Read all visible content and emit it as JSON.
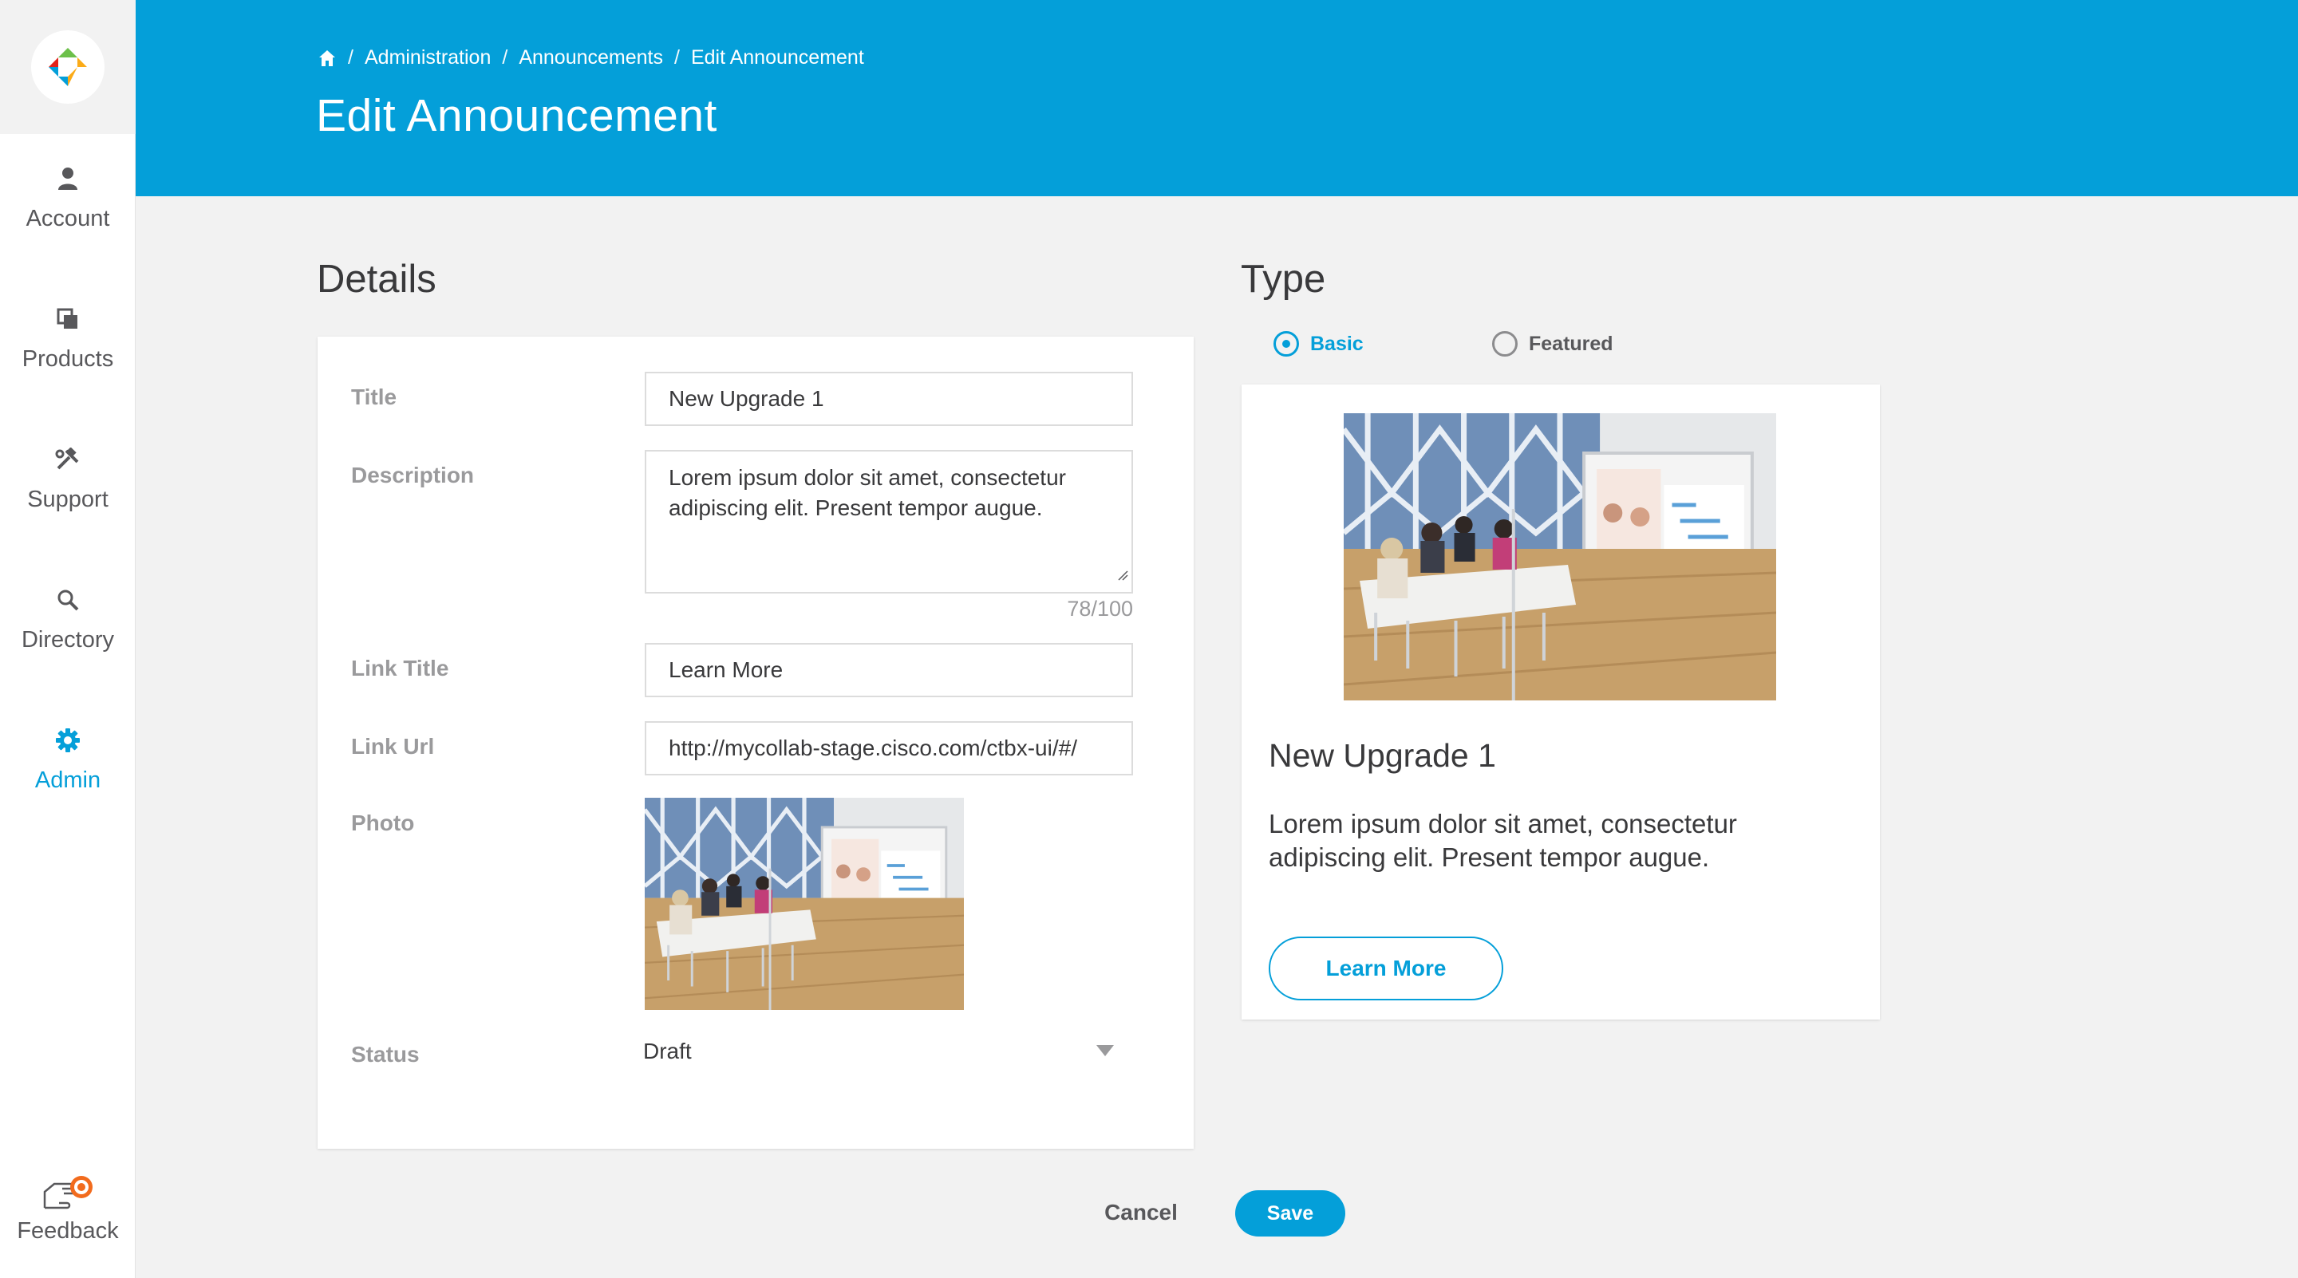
{
  "colors": {
    "brand": "#049fd9",
    "sidebar_bg": "#ffffff",
    "page_bg": "#f2f2f2",
    "feedback_accent": "#f26b1d"
  },
  "sidebar": {
    "logo": "app-logo",
    "items": [
      {
        "label": "Account",
        "icon": "person-icon",
        "active": false
      },
      {
        "label": "Products",
        "icon": "products-icon",
        "active": false
      },
      {
        "label": "Support",
        "icon": "tools-icon",
        "active": false
      },
      {
        "label": "Directory",
        "icon": "search-icon",
        "active": false
      },
      {
        "label": "Admin",
        "icon": "gear-icon",
        "active": true
      }
    ],
    "feedback": {
      "label": "Feedback",
      "icon": "feedback-hand-icon"
    }
  },
  "header": {
    "breadcrumb": [
      "Administration",
      "Announcements",
      "Edit Announcement"
    ],
    "home_icon": "home-icon",
    "title": "Edit Announcement"
  },
  "details": {
    "heading": "Details",
    "fields": {
      "title": {
        "label": "Title",
        "value": "New Upgrade 1"
      },
      "description": {
        "label": "Description",
        "value": "Lorem ipsum dolor sit amet, consectetur adipiscing elit. Present tempor augue.",
        "counter": "78/100"
      },
      "link_title": {
        "label": "Link Title",
        "value": "Learn More"
      },
      "link_url": {
        "label": "Link Url",
        "value": "http://mycollab-stage.cisco.com/ctbx-ui/#/"
      },
      "photo": {
        "label": "Photo",
        "alt": "meeting-room-photo"
      },
      "status": {
        "label": "Status",
        "value": "Draft"
      }
    }
  },
  "type": {
    "heading": "Type",
    "options": [
      {
        "label": "Basic",
        "selected": true
      },
      {
        "label": "Featured",
        "selected": false
      }
    ],
    "preview": {
      "title": "New Upgrade 1",
      "description": "Lorem ipsum dolor sit amet, consectetur adipiscing elit. Present tempor augue.",
      "button_label": "Learn More"
    }
  },
  "actions": {
    "cancel": "Cancel",
    "save": "Save"
  }
}
